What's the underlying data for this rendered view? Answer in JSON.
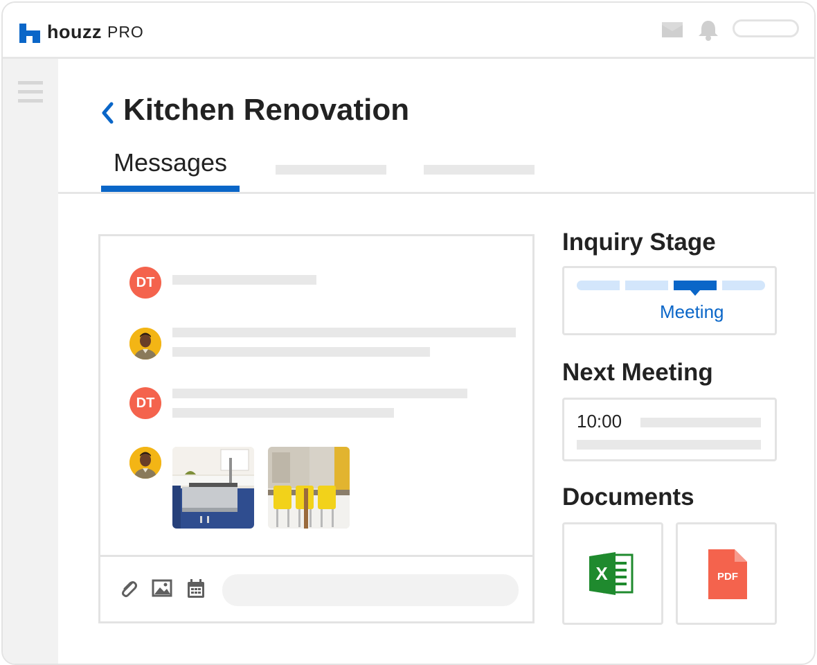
{
  "header": {
    "logo_word": "houzz",
    "logo_sub": "PRO",
    "icons": [
      "mail-icon",
      "bell-icon"
    ]
  },
  "sidebar": {
    "icon": "menu-icon"
  },
  "page": {
    "title": "Kitchen Renovation",
    "back_icon": "chevron-left-icon",
    "tabs": [
      {
        "label": "Messages",
        "active": true
      }
    ]
  },
  "messages": [
    {
      "sender": "DT",
      "type": "text"
    },
    {
      "sender": "photo",
      "type": "text"
    },
    {
      "sender": "DT",
      "type": "text"
    },
    {
      "sender": "photo",
      "type": "images",
      "images": [
        "kitchen-sink-photo",
        "dining-chairs-photo"
      ]
    }
  ],
  "composer": {
    "tools": [
      "paperclip-icon",
      "image-icon",
      "calendar-icon"
    ],
    "input_value": "",
    "placeholder": ""
  },
  "inquiry_stage": {
    "title": "Inquiry Stage",
    "stages_total": 4,
    "current_stage_index": 2,
    "current_label": "Meeting"
  },
  "next_meeting": {
    "title": "Next Meeting",
    "time": "10:00"
  },
  "documents": {
    "title": "Documents",
    "items": [
      {
        "icon": "excel-file-icon",
        "letter": "X"
      },
      {
        "icon": "pdf-file-icon",
        "label": "PDF"
      }
    ]
  },
  "colors": {
    "accent": "#0a66c8",
    "avatar_dt": "#f4634d",
    "stage_inactive": "#d3e6fb",
    "excel_green": "#1f8a2e",
    "pdf_red": "#f4634d"
  }
}
